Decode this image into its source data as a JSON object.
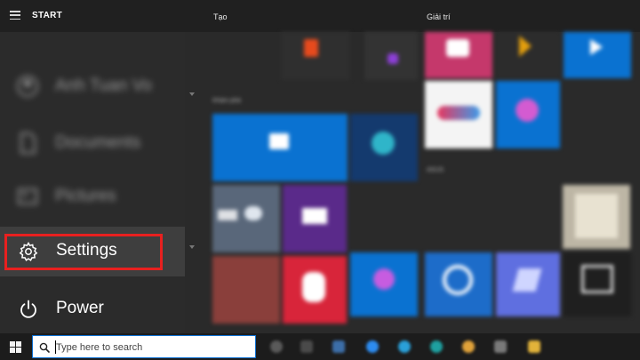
{
  "start_menu": {
    "title": "START",
    "groups": [
      "Tạo",
      "Giải trí"
    ],
    "rail": {
      "user_name": "Anh Tuan Vo",
      "documents_label": "Documents",
      "pictures_label": "Pictures",
      "settings_label": "Settings",
      "power_label": "Power"
    }
  },
  "taskbar": {
    "search_placeholder": "Type here to search"
  },
  "colors": {
    "highlight_border": "#e8201f",
    "tile_blue": "#0a72d1",
    "searchbox_border": "#0b6ed1"
  }
}
